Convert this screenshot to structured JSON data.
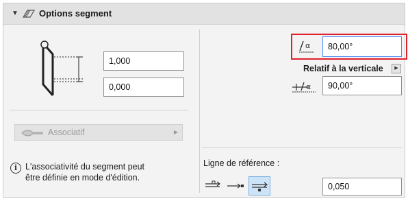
{
  "header": {
    "title": "Options segment"
  },
  "left": {
    "top_value": "1,000",
    "bottom_value": "0,000",
    "associative_label": "Associatif",
    "info_line1": "L'associativité du segment peut",
    "info_line2": "être définie en mode d'édition."
  },
  "right": {
    "angle_value": "80,00°",
    "relative_label": "Relatif à la verticale",
    "angle2_value": "90,00°",
    "reference_label": "Ligne de référence :",
    "offset_value": "0,050"
  },
  "colors": {
    "highlight_frame": "#e0202b",
    "focus_border": "#4c8bf5",
    "selected_bg": "#cde3f7"
  },
  "icons": [
    "chevron-down-icon",
    "segment-icon",
    "stair-section-icon",
    "associative-icon",
    "info-icon",
    "angle-icon",
    "horizontal-angle-icon",
    "ref-line-left-icon",
    "ref-line-center-icon",
    "ref-line-right-icon",
    "dropdown-arrow-icon"
  ]
}
